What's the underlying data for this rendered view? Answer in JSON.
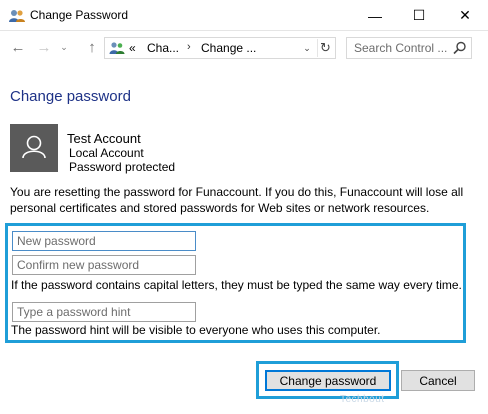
{
  "window": {
    "title": "Change Password",
    "minimize_glyph": "—",
    "maximize_glyph": "☐",
    "close_glyph": "✕",
    "title_icon": "users-icon"
  },
  "nav": {
    "back_glyph": "←",
    "forward_glyph": "→",
    "recent_glyph": "⌄",
    "up_glyph": "↑",
    "address_icon": "control-panel-icon",
    "address_overflow": "«",
    "address_crumbs": [
      "Cha...",
      "Change ..."
    ],
    "crumb_separator": "›",
    "address_dropdown_glyph": "⌄",
    "refresh_glyph": "↻",
    "search_placeholder": "Search Control ...",
    "search_icon": "search-icon"
  },
  "page": {
    "title": "Change password",
    "account": {
      "name": "Test Account",
      "type": "Local Account",
      "status": "Password protected",
      "avatar_icon": "user-icon"
    },
    "warning": "You are resetting the password for Funaccount.  If you do this, Funaccount will lose all personal certificates and stored passwords for Web sites or network resources.",
    "fields": {
      "new_password_placeholder": "New password",
      "confirm_password_placeholder": "Confirm new password",
      "hint_placeholder": "Type a password hint"
    },
    "caps_note": "If the password contains capital letters, they must be typed the same way every time.",
    "hint_note": "The password hint will be visible to everyone who uses this computer."
  },
  "buttons": {
    "change_password": "Change password",
    "cancel": "Cancel"
  },
  "watermark": "Techbout",
  "colors": {
    "accent_title": "#1e3287",
    "highlight": "#1f9ed8",
    "avatar_bg": "#5a5a5a",
    "primary_border": "#0078d7"
  }
}
